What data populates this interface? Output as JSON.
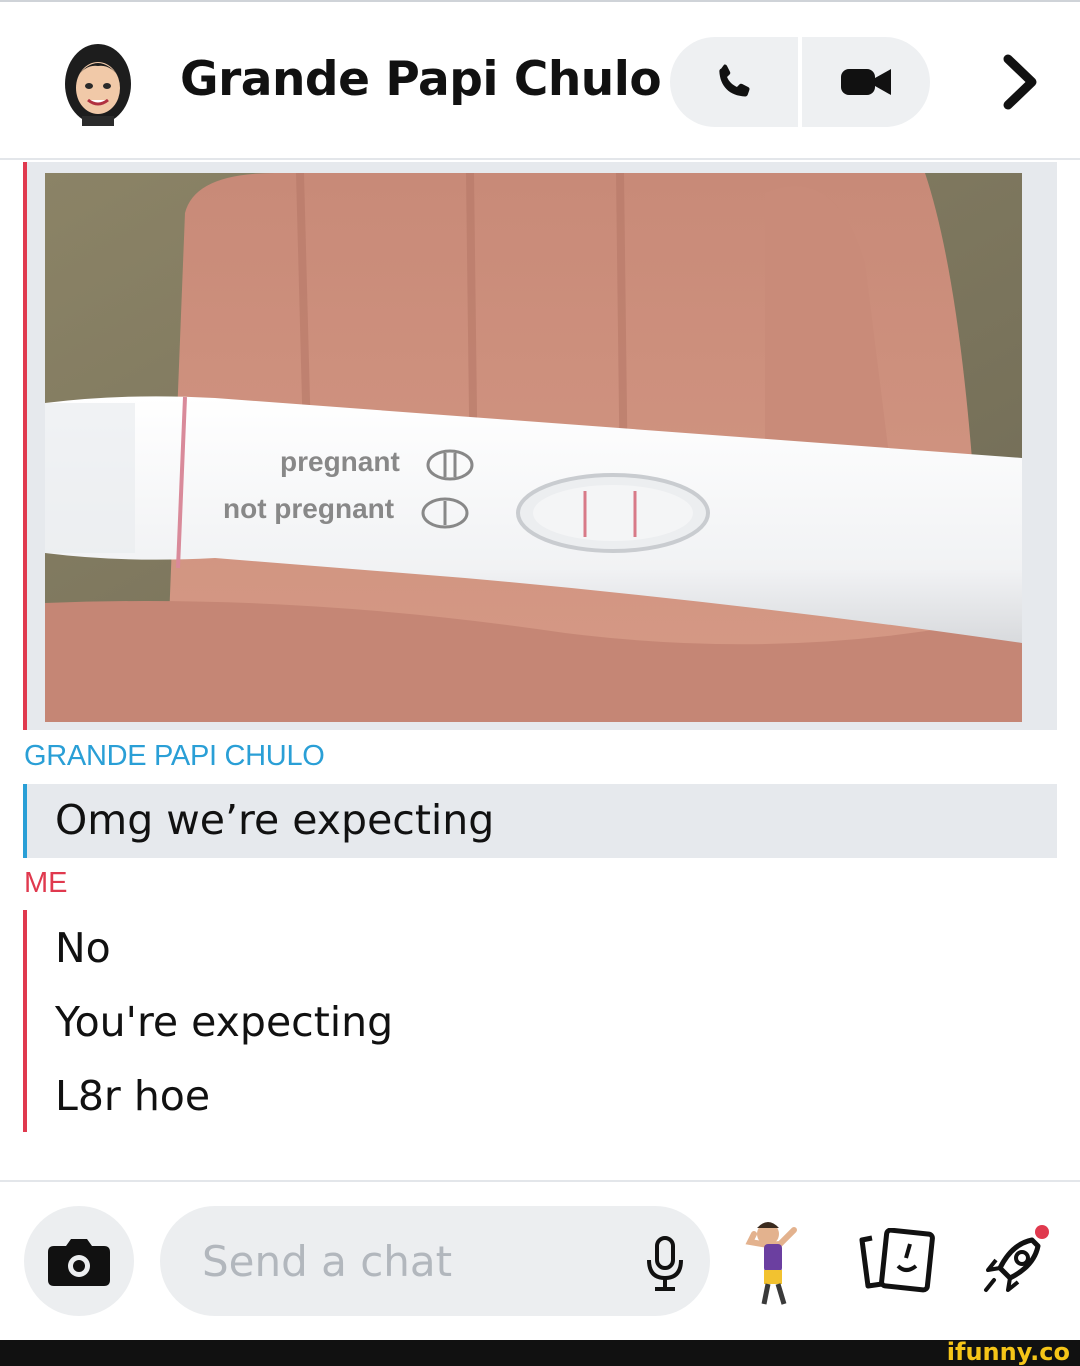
{
  "header": {
    "contact_name": "Grande Papi Chulo"
  },
  "messages": {
    "sender_label": "GRANDE PAPI CHULO",
    "their_message": "Omg we’re expecting",
    "me_label": "ME",
    "my_messages": [
      "No",
      "You're expecting",
      "L8r hoe"
    ]
  },
  "photo": {
    "test_label_pregnant": "pregnant",
    "test_label_not_pregnant": "not pregnant"
  },
  "composer": {
    "placeholder": "Send a chat"
  },
  "watermark": "ifunny.co",
  "colors": {
    "friend_accent": "#2a9fd6",
    "me_accent": "#e0394e",
    "bubble_bg": "#e6e9ed"
  }
}
